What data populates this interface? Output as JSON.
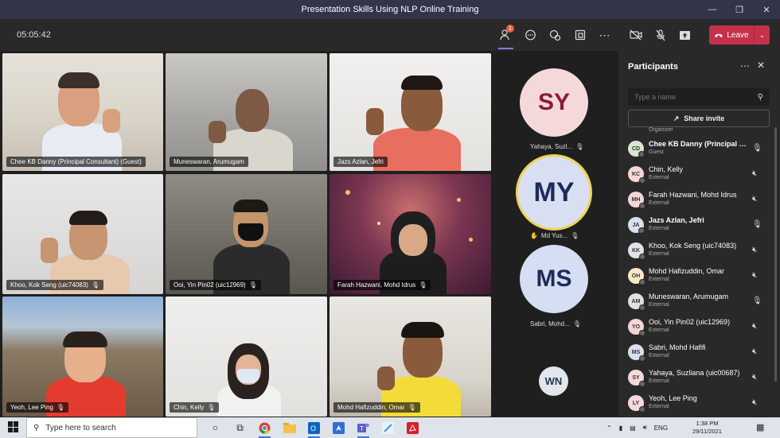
{
  "window": {
    "title": "Presentation Skills Using NLP Online Training",
    "controls": [
      "minimize",
      "restore",
      "close"
    ]
  },
  "meeting": {
    "timer": "05:05:42",
    "participants_badge": "1",
    "leave_label": "Leave"
  },
  "video_tiles": [
    {
      "name": "Chee KB Danny (Principal Consultant) (Guest)",
      "muted": false,
      "speaking": true
    },
    {
      "name": "Muneswaran, Arumugam",
      "muted": false,
      "speaking": false
    },
    {
      "name": "Jazs Azlan, Jefri",
      "muted": false,
      "speaking": true
    },
    {
      "name": "Khoo, Kok Seng (uic74083)",
      "muted": true,
      "speaking": false
    },
    {
      "name": "Ooi, Yin Pin02 (uic12969)",
      "muted": true,
      "speaking": false
    },
    {
      "name": "Farah Hazwani, Mohd Idrus",
      "muted": true,
      "speaking": false
    },
    {
      "name": "Yeoh, Lee Ping",
      "muted": true,
      "speaking": false
    },
    {
      "name": "Chin, Kelly",
      "muted": true,
      "speaking": false
    },
    {
      "name": "Mohd Hafizuddin, Omar",
      "muted": true,
      "speaking": false
    }
  ],
  "avatar_column": [
    {
      "initials": "SY",
      "label": "Yahaya, Suzl...",
      "bg": "#f5d9da",
      "fg": "#8a1a3a"
    },
    {
      "initials": "MY",
      "label": "Md Yus...",
      "bg": "#d9dff2",
      "fg": "#1d2b5a",
      "hand_raised": true
    },
    {
      "initials": "MS",
      "label": "Sabri, Mohd...",
      "bg": "#d6def3",
      "fg": "#1d2b5a"
    },
    {
      "initials": "WN",
      "label": "",
      "bg": "#e3e6ec",
      "fg": "#2a3550"
    }
  ],
  "panel": {
    "title": "Participants",
    "search_placeholder": "Type a name",
    "share_invite": "Share invite",
    "organizer_label": "Organizer",
    "participants": [
      {
        "initials": "CD",
        "name": "Chee KB Danny (Principal Co...",
        "role": "Guest",
        "bold": true,
        "mic": "on",
        "color": "#d4eac8"
      },
      {
        "initials": "KC",
        "name": "Chin, Kelly",
        "role": "External",
        "bold": false,
        "mic": "off",
        "color": "#f3d6d4"
      },
      {
        "initials": "MH",
        "name": "Farah Hazwani, Mohd Idrus",
        "role": "External",
        "bold": false,
        "mic": "off",
        "color": "#f2d7d9"
      },
      {
        "initials": "JA",
        "name": "Jazs Azlan, Jefri",
        "role": "External",
        "bold": true,
        "mic": "on",
        "color": "#d9dff2"
      },
      {
        "initials": "KK",
        "name": "Khoo, Kok Seng (uic74083)",
        "role": "External",
        "bold": false,
        "mic": "off",
        "color": "#e1e3e6"
      },
      {
        "initials": "OH",
        "name": "Mohd Hafizuddin, Omar",
        "role": "External",
        "bold": false,
        "mic": "off",
        "color": "#fbe7c6"
      },
      {
        "initials": "AM",
        "name": "Muneswaran, Arumugam",
        "role": "External",
        "bold": false,
        "mic": "on",
        "color": "#dde2e0"
      },
      {
        "initials": "YO",
        "name": "Ooi, Yin Pin02 (uic12969)",
        "role": "External",
        "bold": false,
        "mic": "off",
        "color": "#f3d6d4"
      },
      {
        "initials": "MS",
        "name": "Sabri, Mohd Hafifi",
        "role": "External",
        "bold": false,
        "mic": "off",
        "color": "#d9dff2"
      },
      {
        "initials": "SY",
        "name": "Yahaya, Suzliana (uic00687)",
        "role": "External",
        "bold": false,
        "mic": "off",
        "color": "#f5d9da"
      },
      {
        "initials": "LY",
        "name": "Yeoh, Lee Ping",
        "role": "External",
        "bold": false,
        "mic": "off",
        "color": "#f5d9da"
      }
    ]
  },
  "taskbar": {
    "search_placeholder": "Type here to search",
    "language": "ENG",
    "time": "1:38 PM",
    "date": "29/11/2021"
  }
}
